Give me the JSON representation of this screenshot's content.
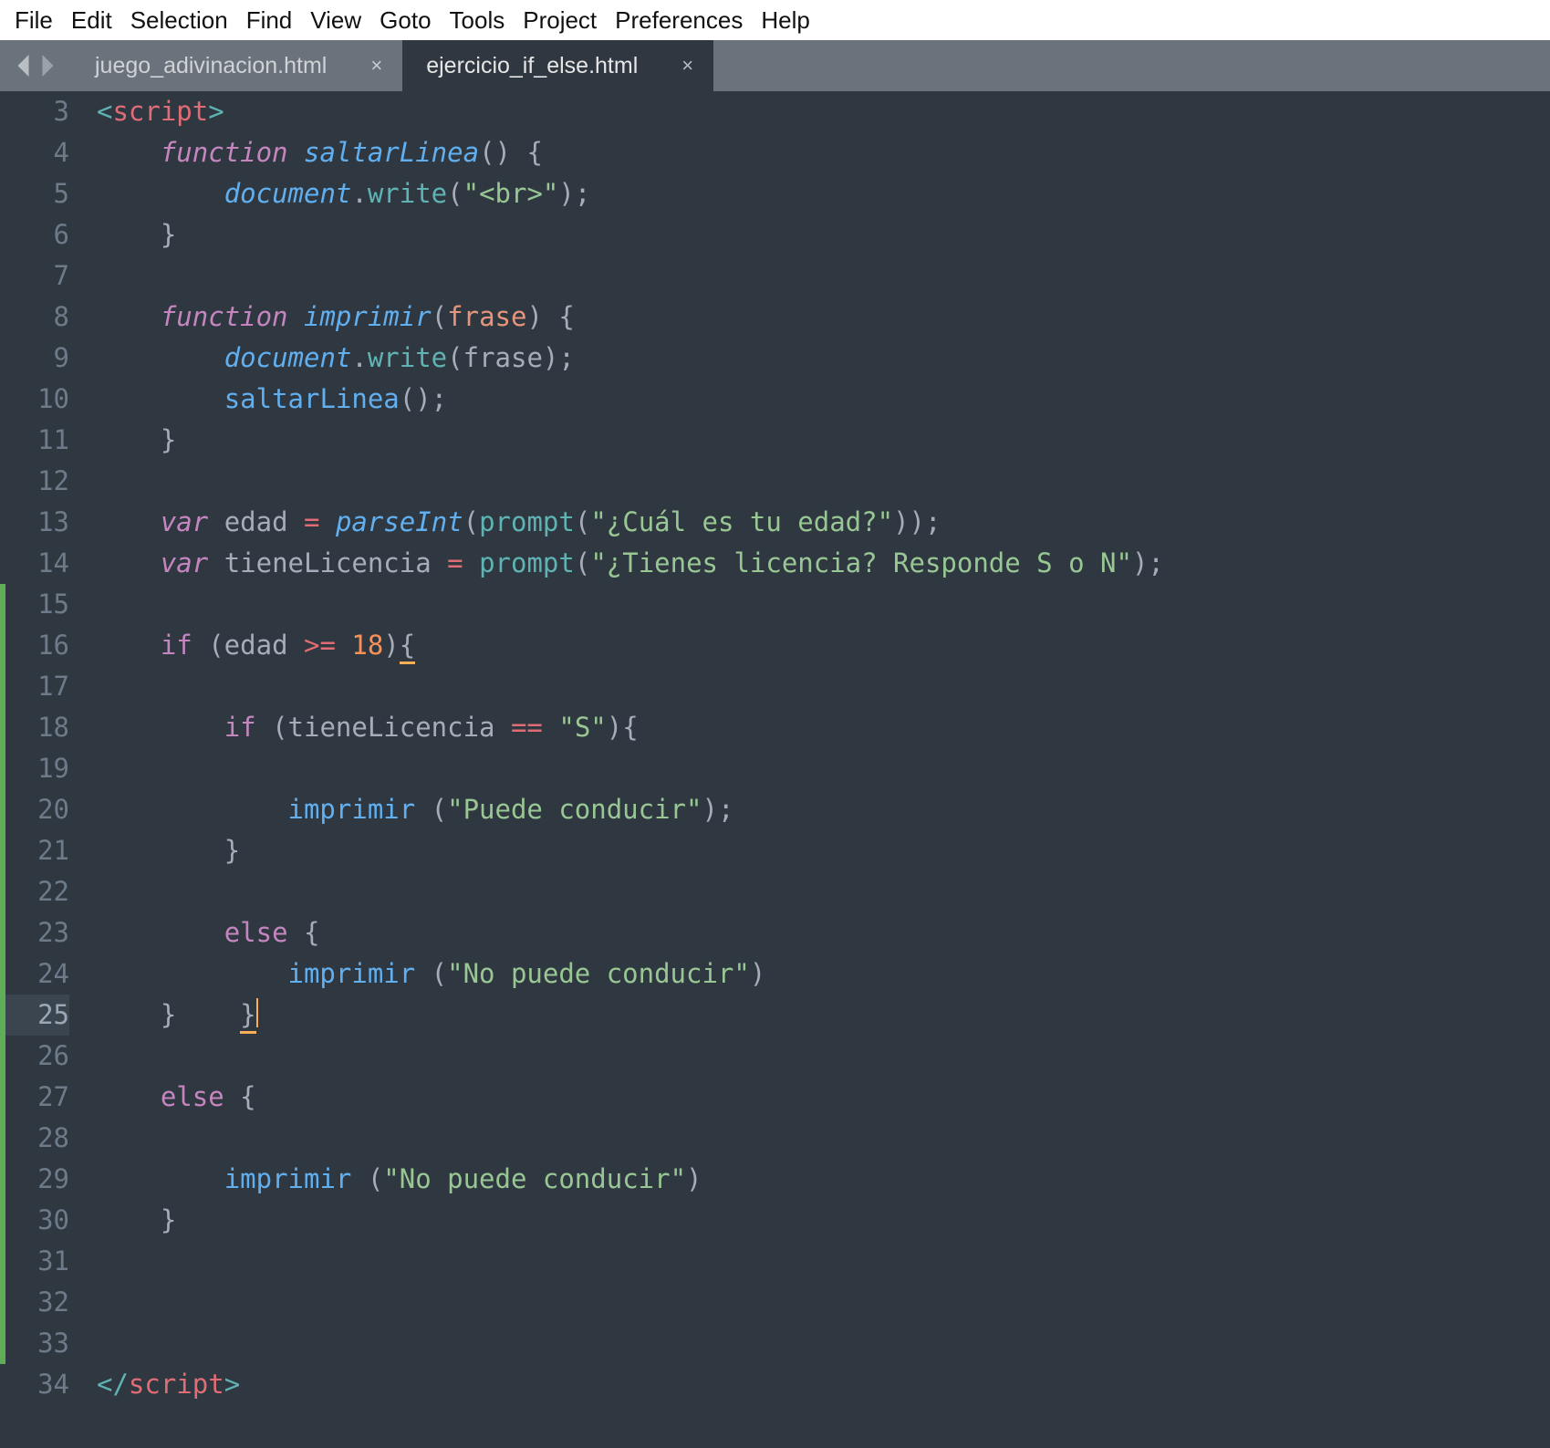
{
  "menu": [
    "File",
    "Edit",
    "Selection",
    "Find",
    "View",
    "Goto",
    "Tools",
    "Project",
    "Preferences",
    "Help"
  ],
  "tabs": [
    {
      "label": "juego_adivinacion.html",
      "active": false
    },
    {
      "label": "ejercicio_if_else.html",
      "active": true
    }
  ],
  "first_line_number": 3,
  "current_line_number": 25,
  "modified_ranges": [
    [
      15,
      33
    ]
  ],
  "code_lines": [
    {
      "n": 3,
      "indent": 0,
      "tokens": [
        [
          "angle",
          "<"
        ],
        [
          "tag",
          "script"
        ],
        [
          "angle",
          ">"
        ]
      ]
    },
    {
      "n": 4,
      "indent": 1,
      "tokens": [
        [
          "kw",
          "function"
        ],
        [
          "pun",
          " "
        ],
        [
          "fname",
          "saltarLinea"
        ],
        [
          "pun",
          "() {"
        ]
      ]
    },
    {
      "n": 5,
      "indent": 2,
      "tokens": [
        [
          "obj",
          "document"
        ],
        [
          "pun",
          "."
        ],
        [
          "call",
          "write"
        ],
        [
          "pun",
          "("
        ],
        [
          "str",
          "\"<br>\""
        ],
        [
          "pun",
          ");"
        ]
      ]
    },
    {
      "n": 6,
      "indent": 1,
      "tokens": [
        [
          "pun",
          "}"
        ]
      ]
    },
    {
      "n": 7,
      "indent": 0,
      "tokens": []
    },
    {
      "n": 8,
      "indent": 1,
      "tokens": [
        [
          "kw",
          "function"
        ],
        [
          "pun",
          " "
        ],
        [
          "fname",
          "imprimir"
        ],
        [
          "pun",
          "("
        ],
        [
          "param",
          "frase"
        ],
        [
          "pun",
          ") {"
        ]
      ]
    },
    {
      "n": 9,
      "indent": 2,
      "tokens": [
        [
          "obj",
          "document"
        ],
        [
          "pun",
          "."
        ],
        [
          "call",
          "write"
        ],
        [
          "pun",
          "(frase);"
        ]
      ]
    },
    {
      "n": 10,
      "indent": 2,
      "tokens": [
        [
          "call2",
          "saltarLinea"
        ],
        [
          "pun",
          "();"
        ]
      ]
    },
    {
      "n": 11,
      "indent": 1,
      "tokens": [
        [
          "pun",
          "}"
        ]
      ]
    },
    {
      "n": 12,
      "indent": 0,
      "tokens": []
    },
    {
      "n": 13,
      "indent": 1,
      "tokens": [
        [
          "kw",
          "var"
        ],
        [
          "pun",
          " edad "
        ],
        [
          "op",
          "="
        ],
        [
          "pun",
          " "
        ],
        [
          "fname",
          "parseInt"
        ],
        [
          "pun",
          "("
        ],
        [
          "call",
          "prompt"
        ],
        [
          "pun",
          "("
        ],
        [
          "str",
          "\"¿Cuál es tu edad?\""
        ],
        [
          "pun",
          "));"
        ]
      ]
    },
    {
      "n": 14,
      "indent": 1,
      "tokens": [
        [
          "kw",
          "var"
        ],
        [
          "pun",
          " tieneLicencia "
        ],
        [
          "op",
          "="
        ],
        [
          "pun",
          " "
        ],
        [
          "call",
          "prompt"
        ],
        [
          "pun",
          "("
        ],
        [
          "str",
          "\"¿Tienes licencia? Responde S o N\""
        ],
        [
          "pun",
          ");"
        ]
      ]
    },
    {
      "n": 15,
      "indent": 0,
      "tokens": []
    },
    {
      "n": 16,
      "indent": 1,
      "tokens": [
        [
          "kw-ns",
          "if"
        ],
        [
          "pun",
          " (edad "
        ],
        [
          "op",
          ">="
        ],
        [
          "pun",
          " "
        ],
        [
          "num",
          "18"
        ],
        [
          "pun",
          ")"
        ],
        [
          "pun-under",
          "{"
        ]
      ]
    },
    {
      "n": 17,
      "indent": 0,
      "tokens": []
    },
    {
      "n": 18,
      "indent": 2,
      "tokens": [
        [
          "kw-ns",
          "if"
        ],
        [
          "pun",
          " (tieneLicencia "
        ],
        [
          "op",
          "=="
        ],
        [
          "pun",
          " "
        ],
        [
          "str",
          "\"S\""
        ],
        [
          "pun",
          "){"
        ]
      ]
    },
    {
      "n": 19,
      "indent": 0,
      "tokens": []
    },
    {
      "n": 20,
      "indent": 3,
      "tokens": [
        [
          "call2",
          "imprimir"
        ],
        [
          "pun",
          " ("
        ],
        [
          "str",
          "\"Puede conducir\""
        ],
        [
          "pun",
          ");"
        ]
      ]
    },
    {
      "n": 21,
      "indent": 2,
      "tokens": [
        [
          "pun",
          "}"
        ]
      ]
    },
    {
      "n": 22,
      "indent": 0,
      "tokens": []
    },
    {
      "n": 23,
      "indent": 2,
      "tokens": [
        [
          "kw-ns",
          "else"
        ],
        [
          "pun",
          " {"
        ]
      ]
    },
    {
      "n": 24,
      "indent": 3,
      "tokens": [
        [
          "call2",
          "imprimir"
        ],
        [
          "pun",
          " ("
        ],
        [
          "str",
          "\"No puede conducir\""
        ],
        [
          "pun",
          ")"
        ]
      ]
    },
    {
      "n": 25,
      "indent": 1,
      "tokens": [
        [
          "pun",
          "}    "
        ],
        [
          "pun-under",
          "}"
        ],
        [
          "caret",
          ""
        ]
      ]
    },
    {
      "n": 26,
      "indent": 0,
      "tokens": []
    },
    {
      "n": 27,
      "indent": 1,
      "tokens": [
        [
          "kw-ns",
          "else"
        ],
        [
          "pun",
          " {"
        ]
      ]
    },
    {
      "n": 28,
      "indent": 0,
      "tokens": []
    },
    {
      "n": 29,
      "indent": 2,
      "tokens": [
        [
          "call2",
          "imprimir"
        ],
        [
          "pun",
          " ("
        ],
        [
          "str",
          "\"No puede conducir\""
        ],
        [
          "pun",
          ")"
        ]
      ]
    },
    {
      "n": 30,
      "indent": 1,
      "tokens": [
        [
          "pun",
          "}"
        ]
      ]
    },
    {
      "n": 31,
      "indent": 0,
      "tokens": []
    },
    {
      "n": 32,
      "indent": 0,
      "tokens": []
    },
    {
      "n": 33,
      "indent": 0,
      "tokens": []
    },
    {
      "n": 34,
      "indent": 0,
      "tokens": [
        [
          "angle",
          "</"
        ],
        [
          "tag",
          "script"
        ],
        [
          "angle",
          ">"
        ]
      ]
    }
  ]
}
